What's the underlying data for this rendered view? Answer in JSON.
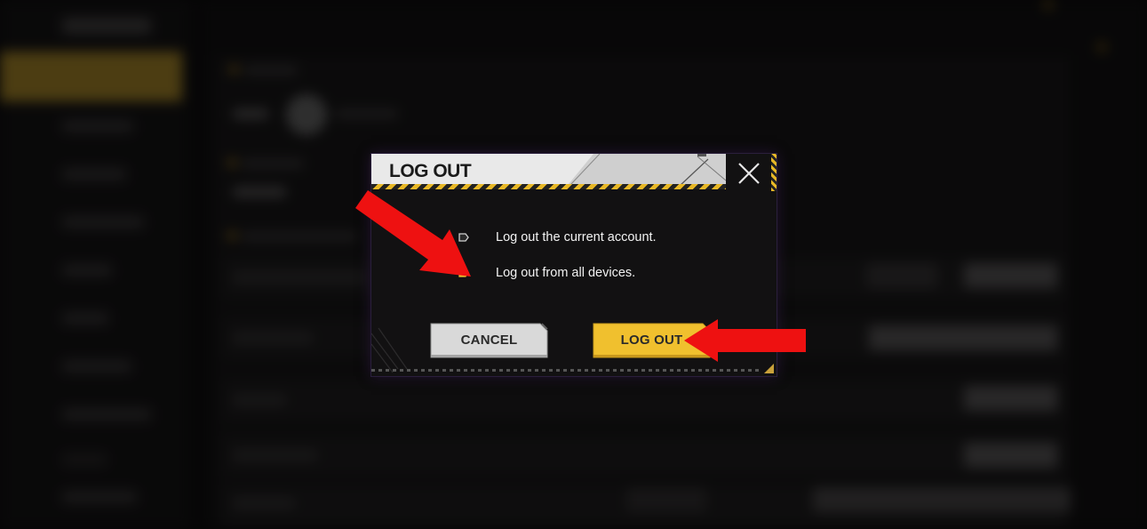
{
  "dialog": {
    "title": "LOG OUT",
    "close_icon": "close-x-icon",
    "options": [
      {
        "label": "Log out the current account.",
        "selected": false,
        "bullet_icon": "tag-bullet-icon"
      },
      {
        "label": "Log out from all devices.",
        "selected": true,
        "bullet_icon": "tag-bullet-icon"
      }
    ],
    "cancel_label": "CANCEL",
    "logout_label": "LOG OUT"
  },
  "annotations": {
    "arrow_icons": [
      "red-arrow-icon",
      "red-arrow-icon"
    ],
    "color": "#ee1111"
  },
  "colors": {
    "accent": "#f0c02e",
    "header_bg": "#e9e9e9",
    "dialog_bg": "#121112",
    "cancel_bg": "#d9d9d9",
    "sidebar_active": "#8a6f22"
  }
}
